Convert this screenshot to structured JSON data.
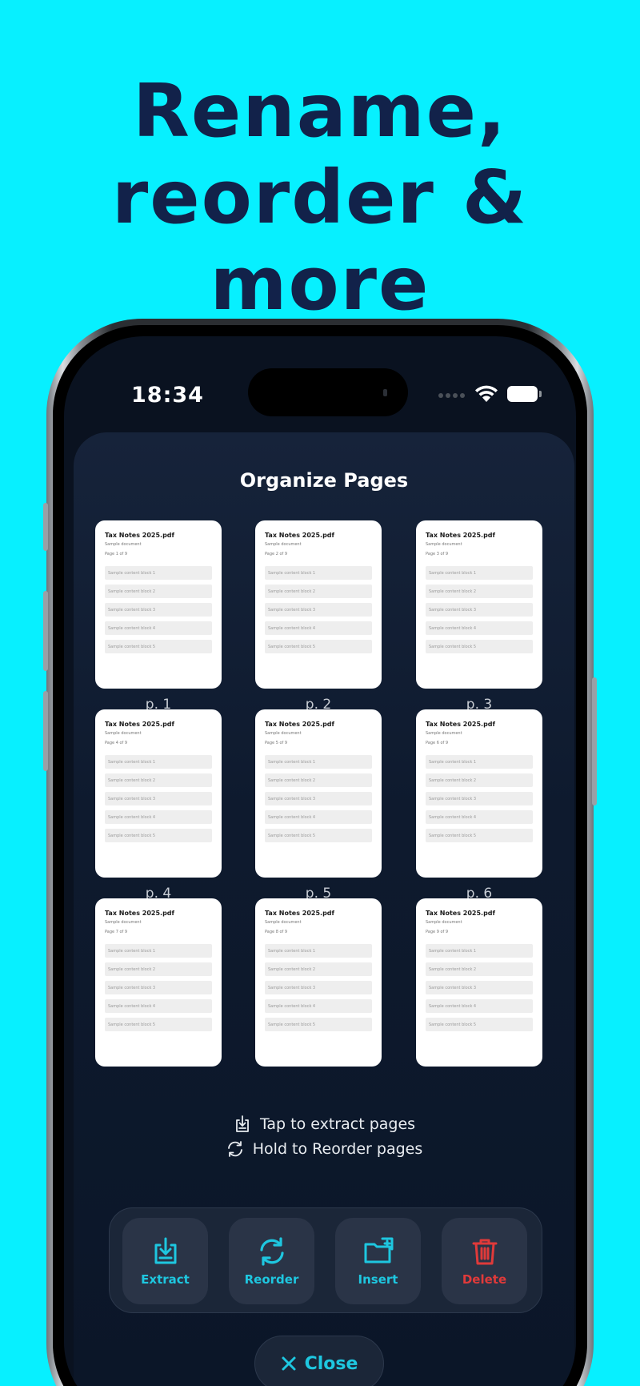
{
  "headline": {
    "line1": "Rename,",
    "line2": "reorder & more"
  },
  "status_bar": {
    "time": "18:34"
  },
  "sheet": {
    "title": "Organize Pages"
  },
  "pages": [
    {
      "title": "Tax Notes 2025.pdf",
      "subtitle": "Sample document",
      "page_text": "Page 1 of 9",
      "blocks": [
        "Sample content block 1",
        "Sample content block 2",
        "Sample content block 3",
        "Sample content block 4",
        "Sample content block 5"
      ],
      "label": "p. 1"
    },
    {
      "title": "Tax Notes 2025.pdf",
      "subtitle": "Sample document",
      "page_text": "Page 2 of 9",
      "blocks": [
        "Sample content block 1",
        "Sample content block 2",
        "Sample content block 3",
        "Sample content block 4",
        "Sample content block 5"
      ],
      "label": "p. 2"
    },
    {
      "title": "Tax Notes 2025.pdf",
      "subtitle": "Sample document",
      "page_text": "Page 3 of 9",
      "blocks": [
        "Sample content block 1",
        "Sample content block 2",
        "Sample content block 3",
        "Sample content block 4",
        "Sample content block 5"
      ],
      "label": "p. 3"
    },
    {
      "title": "Tax Notes 2025.pdf",
      "subtitle": "Sample document",
      "page_text": "Page 4 of 9",
      "blocks": [
        "Sample content block 1",
        "Sample content block 2",
        "Sample content block 3",
        "Sample content block 4",
        "Sample content block 5"
      ],
      "label": "p. 4"
    },
    {
      "title": "Tax Notes 2025.pdf",
      "subtitle": "Sample document",
      "page_text": "Page 5 of 9",
      "blocks": [
        "Sample content block 1",
        "Sample content block 2",
        "Sample content block 3",
        "Sample content block 4",
        "Sample content block 5"
      ],
      "label": "p. 5"
    },
    {
      "title": "Tax Notes 2025.pdf",
      "subtitle": "Sample document",
      "page_text": "Page 6 of 9",
      "blocks": [
        "Sample content block 1",
        "Sample content block 2",
        "Sample content block 3",
        "Sample content block 4",
        "Sample content block 5"
      ],
      "label": "p. 6"
    },
    {
      "title": "Tax Notes 2025.pdf",
      "subtitle": "Sample document",
      "page_text": "Page 7 of 9",
      "blocks": [
        "Sample content block 1",
        "Sample content block 2",
        "Sample content block 3",
        "Sample content block 4",
        "Sample content block 5"
      ],
      "label": ""
    },
    {
      "title": "Tax Notes 2025.pdf",
      "subtitle": "Sample document",
      "page_text": "Page 8 of 9",
      "blocks": [
        "Sample content block 1",
        "Sample content block 2",
        "Sample content block 3",
        "Sample content block 4",
        "Sample content block 5"
      ],
      "label": ""
    },
    {
      "title": "Tax Notes 2025.pdf",
      "subtitle": "Sample document",
      "page_text": "Page 9 of 9",
      "blocks": [
        "Sample content block 1",
        "Sample content block 2",
        "Sample content block 3",
        "Sample content block 4",
        "Sample content block 5"
      ],
      "label": ""
    }
  ],
  "hints": {
    "extract": {
      "icon": "extract-icon",
      "text": "Tap to extract pages"
    },
    "reorder": {
      "icon": "reorder-icon",
      "text": "Hold to Reorder pages"
    }
  },
  "toolbar": {
    "extract": {
      "icon": "extract-icon",
      "label": "Extract"
    },
    "reorder": {
      "icon": "reorder-icon",
      "label": "Reorder"
    },
    "insert": {
      "icon": "insert-folder-icon",
      "label": "Insert"
    },
    "delete": {
      "icon": "trash-icon",
      "label": "Delete"
    }
  },
  "close_button": {
    "icon": "close-icon",
    "label": "Close"
  },
  "colors": {
    "background": "#07F0FF",
    "headline": "#12224A",
    "accent": "#1EC7E0",
    "danger": "#E03A3A",
    "sheet": "#0E1A2E"
  }
}
